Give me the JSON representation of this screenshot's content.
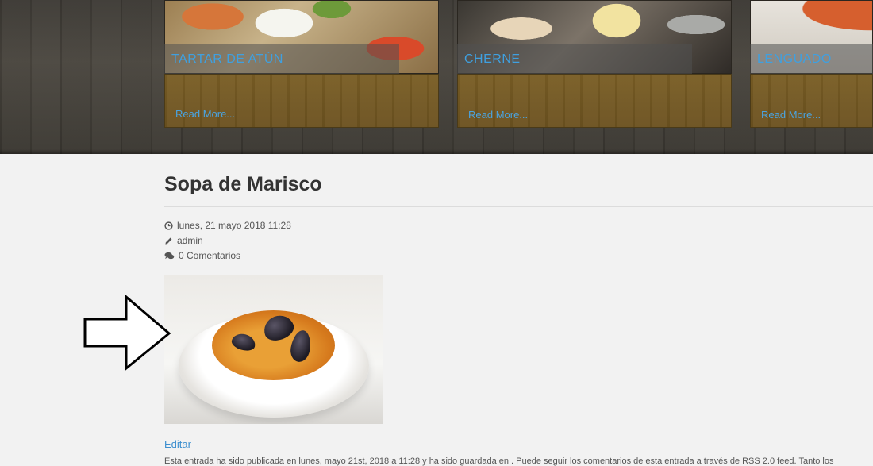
{
  "cards": [
    {
      "title": "TARTAR DE ATÚN",
      "read_more": "Read More..."
    },
    {
      "title": "CHERNE",
      "read_more": "Read More..."
    },
    {
      "title": "LENGUADO",
      "read_more": "Read More..."
    }
  ],
  "post": {
    "title": "Sopa de Marisco",
    "date": "lunes, 21 mayo 2018 11:28",
    "author": "admin",
    "comments": "0 Comentarios",
    "edit_label": "Editar",
    "body_excerpt": "Esta entrada ha sido publicada en lunes, mayo 21st, 2018 a 11:28 y ha sido guardada en . Puede seguir los comentarios de esta entrada a través de RSS 2.0 feed. Tanto los"
  },
  "colors": {
    "link": "#3d8fcf",
    "card_title": "#3fa0e0",
    "background": "#f2f2f2"
  },
  "icons": {
    "date": "clock-icon",
    "author": "pencil-icon",
    "comments": "comments-icon",
    "annotation": "arrow-right-icon"
  }
}
